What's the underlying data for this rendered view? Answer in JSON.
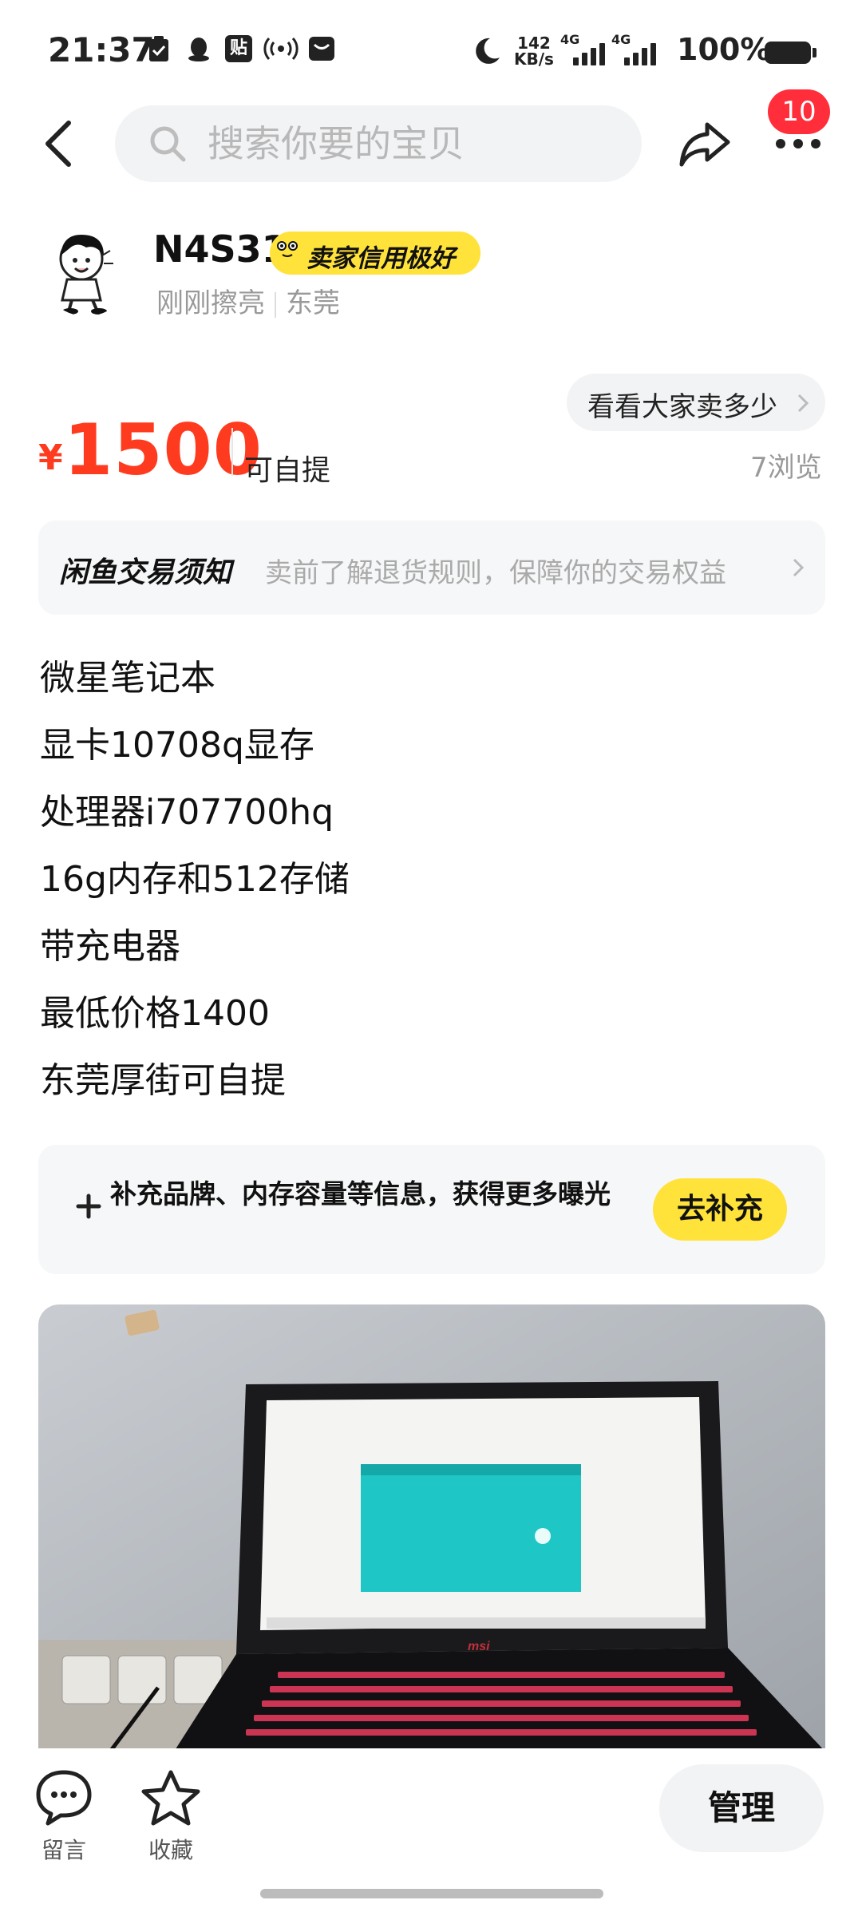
{
  "status_bar": {
    "time": "21:37",
    "net_speed_value": "142",
    "net_speed_unit": "KB/s",
    "sim1": "4G",
    "sim2": "4G",
    "battery": "100%",
    "icons": [
      "clipboard-check-icon",
      "qq-icon",
      "tie-icon",
      "hotspot-icon",
      "mail-icon",
      "moon-icon"
    ]
  },
  "header": {
    "search_placeholder": "搜索你要的宝贝",
    "notification_count": "10"
  },
  "seller": {
    "name": "N4S31",
    "credit_badge": "卖家信用极好",
    "active": "刚刚擦亮",
    "location": "东莞"
  },
  "price": {
    "currency": "¥",
    "amount": "1500",
    "delivery": "可自提",
    "see_market_price": "看看大家卖多少",
    "views": "7浏览"
  },
  "notice": {
    "title": "闲鱼交易须知",
    "description": "卖前了解退货规则，保障你的交易权益"
  },
  "description_lines": [
    "微星笔记本",
    "显卡10708q显存",
    "处理器i707700hq",
    "16g内存和512存储",
    "带充电器",
    "最低价格1400",
    "东莞厚街可自提"
  ],
  "supplement": {
    "text": "补充品牌、内存容量等信息，获得更多曝光",
    "button": "去补充"
  },
  "photo": {
    "brand_logo": "msi"
  },
  "bottom_bar": {
    "comment_label": "留言",
    "favorite_label": "收藏",
    "manage_label": "管理"
  },
  "colors": {
    "price": "#ff3b1f",
    "accent_yellow": "#ffe23a",
    "badge_red": "#ff2e3a"
  }
}
